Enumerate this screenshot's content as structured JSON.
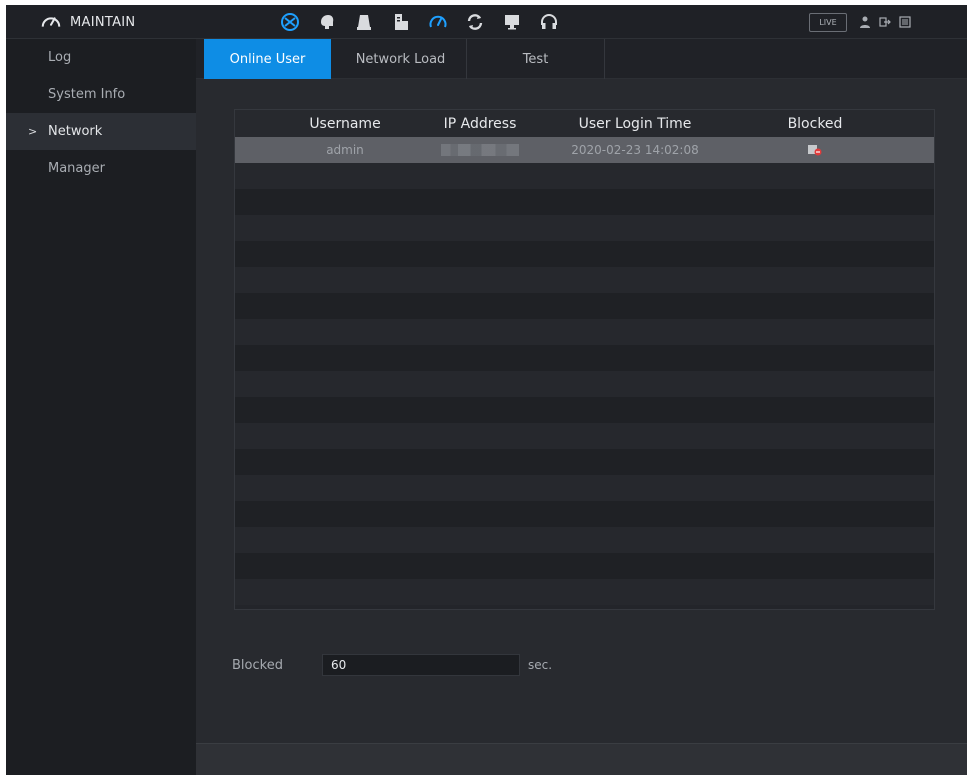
{
  "header": {
    "title": "MAINTAIN",
    "title_icon": "gauge-icon",
    "live_label": "LIVE",
    "icons": [
      "network-globe-icon",
      "brain-icon",
      "storage-icon",
      "device-icon",
      "gauge-icon",
      "refresh-icon",
      "monitor-icon",
      "headset-icon"
    ],
    "tray_icons": [
      "user-icon",
      "logout-icon",
      "menu-icon"
    ]
  },
  "sidebar": {
    "items": [
      {
        "label": "Log"
      },
      {
        "label": "System Info"
      },
      {
        "label": "Network",
        "arrow": ">"
      },
      {
        "label": "Manager"
      }
    ]
  },
  "tabs": [
    {
      "label": "Online User"
    },
    {
      "label": "Network Load"
    },
    {
      "label": "Test"
    }
  ],
  "table": {
    "columns": [
      "Username",
      "IP Address",
      "User Login Time",
      "Blocked"
    ],
    "rows": [
      {
        "username": "admin",
        "login_time": "2020-02-23 14:02:08",
        "blocked_icon": "block-user-icon"
      }
    ]
  },
  "blocked": {
    "label": "Blocked",
    "value": "60",
    "unit": "sec."
  },
  "colors": {
    "accent": "#0e8de5",
    "active_icon": "#1ea0ff",
    "block_icon_red": "#e23b3b"
  }
}
